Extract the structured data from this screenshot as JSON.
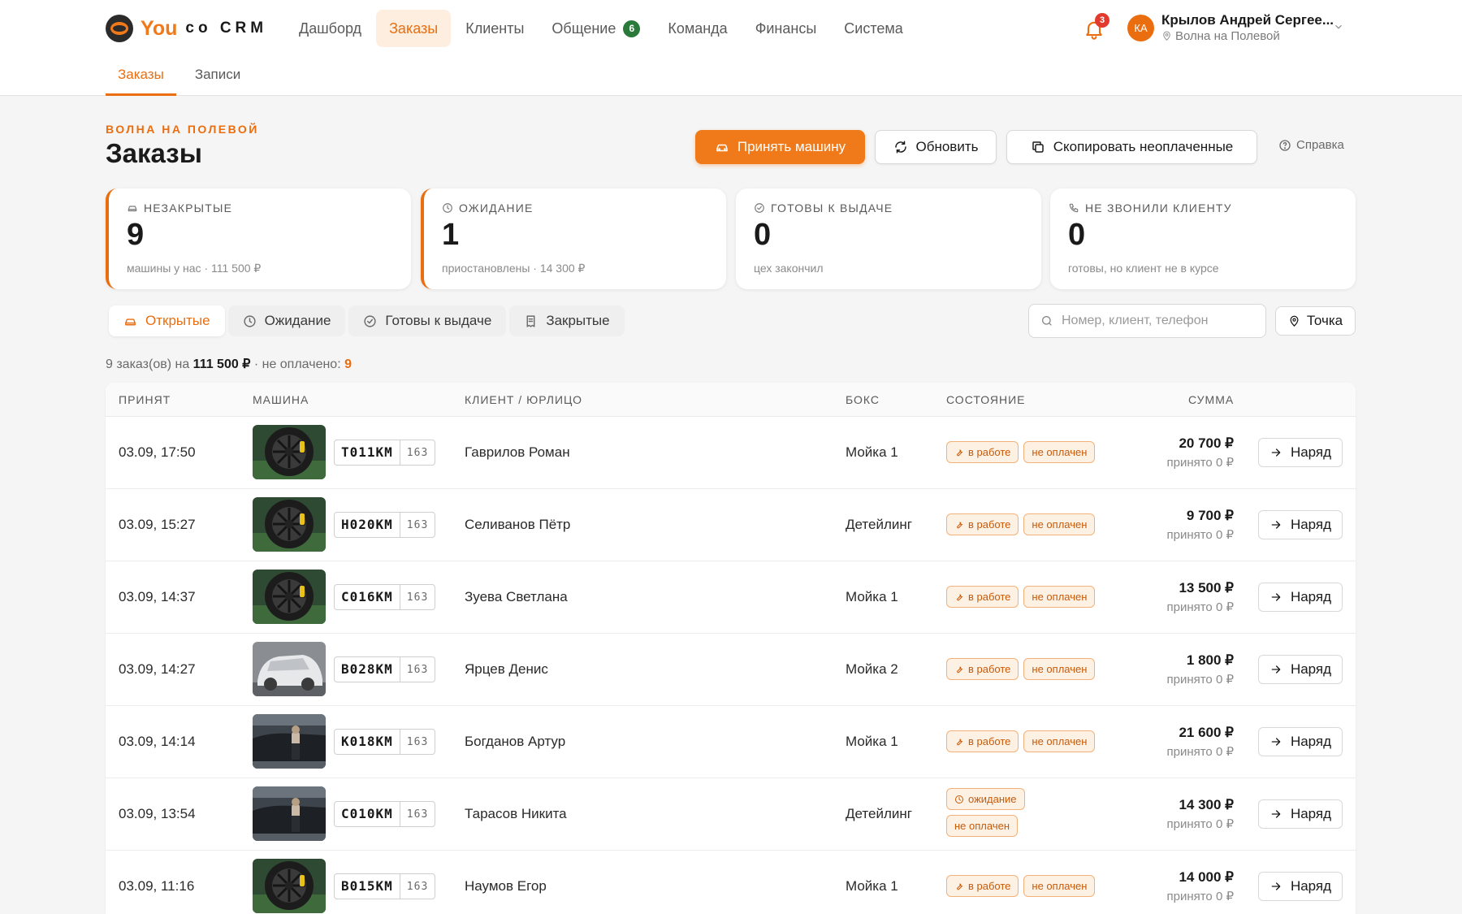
{
  "header": {
    "logo_you": "You",
    "logo_crm": "co CRM",
    "nav": [
      {
        "label": "Дашборд",
        "active": false
      },
      {
        "label": "Заказы",
        "active": true
      },
      {
        "label": "Клиенты",
        "active": false
      },
      {
        "label": "Общение",
        "active": false,
        "badge": "6"
      },
      {
        "label": "Команда",
        "active": false
      },
      {
        "label": "Финансы",
        "active": false
      },
      {
        "label": "Система",
        "active": false
      }
    ],
    "notifications_count": "3",
    "user": {
      "initials": "КА",
      "name": "Крылов Андрей Сергее...",
      "location": "Волна на Полевой"
    },
    "subtabs": [
      {
        "label": "Заказы",
        "active": true
      },
      {
        "label": "Записи",
        "active": false
      }
    ]
  },
  "page": {
    "section": "ВОЛНА НА ПОЛЕВОЙ",
    "title": "Заказы",
    "buttons": {
      "accept": "Принять машину",
      "refresh": "Обновить",
      "copy_unpaid": "Скопировать неоплаченные",
      "help": "Справка"
    }
  },
  "stats": [
    {
      "label": "НЕЗАКРЫТЫЕ",
      "value": "9",
      "sub": "машины у нас · 111 500 ₽",
      "icon": "car-icon"
    },
    {
      "label": "ОЖИДАНИЕ",
      "value": "1",
      "sub": "приостановлены · 14 300 ₽",
      "icon": "clock-icon"
    },
    {
      "label": "ГОТОВЫ К ВЫДАЧЕ",
      "value": "0",
      "sub": "цех закончил",
      "icon": "check-circle-icon"
    },
    {
      "label": "НЕ ЗВОНИЛИ КЛИЕНТУ",
      "value": "0",
      "sub": "готовы, но клиент не в курсе",
      "icon": "phone-icon"
    }
  ],
  "filters": [
    {
      "label": "Открытые",
      "active": true
    },
    {
      "label": "Ожидание",
      "active": false
    },
    {
      "label": "Готовы к выдаче",
      "active": false
    },
    {
      "label": "Закрытые",
      "active": false
    }
  ],
  "search": {
    "placeholder": "Номер, клиент, телефон",
    "value": ""
  },
  "point_button": "Точка",
  "summary": {
    "prefix": "9 заказ(ов) на",
    "amount": "111 500 ₽",
    "unpaid_label": "· не оплачено:",
    "unpaid_count": "9"
  },
  "table": {
    "headers": {
      "accepted": "ПРИНЯТ",
      "car": "МАШИНА",
      "client": "КЛИЕНТ / ЮРЛИЦО",
      "box": "БОКС",
      "status": "СОСТОЯНИЕ",
      "sum": "СУММА"
    },
    "rows": [
      {
        "date": "03.09, 17:50",
        "plate": "Т011КМ",
        "region": "163",
        "photo": "wheel",
        "client": "Гаврилов Роман",
        "box": "Мойка 1",
        "statuses": [
          "в работе",
          "не оплачен"
        ],
        "stacked": false,
        "sum": "20 700 ₽",
        "paid": "принято 0 ₽",
        "action": "Наряд"
      },
      {
        "date": "03.09, 15:27",
        "plate": "Н020КМ",
        "region": "163",
        "photo": "wheel",
        "client": "Селиванов Пётр",
        "box": "Детейлинг",
        "statuses": [
          "в работе",
          "не оплачен"
        ],
        "stacked": false,
        "sum": "9 700 ₽",
        "paid": "принято 0 ₽",
        "action": "Наряд"
      },
      {
        "date": "03.09, 14:37",
        "plate": "С016КМ",
        "region": "163",
        "photo": "wheel",
        "client": "Зуева Светлана",
        "box": "Мойка 1",
        "statuses": [
          "в работе",
          "не оплачен"
        ],
        "stacked": false,
        "sum": "13 500 ₽",
        "paid": "принято 0 ₽",
        "action": "Наряд"
      },
      {
        "date": "03.09, 14:27",
        "plate": "В028КМ",
        "region": "163",
        "photo": "foam",
        "client": "Ярцев Денис",
        "box": "Мойка 2",
        "statuses": [
          "в работе",
          "не оплачен"
        ],
        "stacked": false,
        "sum": "1 800 ₽",
        "paid": "принято 0 ₽",
        "action": "Наряд"
      },
      {
        "date": "03.09, 14:14",
        "plate": "К018КМ",
        "region": "163",
        "photo": "garage",
        "client": "Богданов Артур",
        "box": "Мойка 1",
        "statuses": [
          "в работе",
          "не оплачен"
        ],
        "stacked": false,
        "sum": "21 600 ₽",
        "paid": "принято 0 ₽",
        "action": "Наряд"
      },
      {
        "date": "03.09, 13:54",
        "plate": "С010КМ",
        "region": "163",
        "photo": "garage",
        "client": "Тарасов Никита",
        "box": "Детейлинг",
        "statuses": [
          "ожидание",
          "не оплачен"
        ],
        "stacked": true,
        "sum": "14 300 ₽",
        "paid": "принято 0 ₽",
        "action": "Наряд"
      },
      {
        "date": "03.09, 11:16",
        "plate": "В015КМ",
        "region": "163",
        "photo": "wheel",
        "client": "Наумов Егор",
        "box": "Мойка 1",
        "statuses": [
          "в работе",
          "не оплачен"
        ],
        "stacked": false,
        "sum": "14 000 ₽",
        "paid": "принято 0 ₽",
        "action": "Наряд"
      }
    ]
  },
  "colors": {
    "accent": "#f07a1a",
    "accent_text": "#ea6e10",
    "badge_green": "#2b7a3b",
    "notify_red": "#e23b2e"
  }
}
